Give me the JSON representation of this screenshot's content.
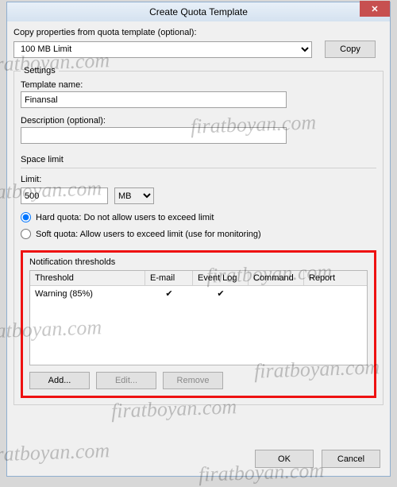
{
  "title": "Create Quota Template",
  "copy_label": "Copy properties from quota template (optional):",
  "template_select": "100 MB Limit",
  "copy_btn": "Copy",
  "settings_legend": "Settings",
  "tmpl_label": "Template name:",
  "tmpl_value": "Finansal",
  "desc_label": "Description (optional):",
  "desc_value": "",
  "space_label": "Space limit",
  "limit_label": "Limit:",
  "limit_value": "500",
  "unit": "MB",
  "hard_label": "Hard quota: Do not allow users to exceed limit",
  "soft_label": "Soft quota: Allow users to exceed limit (use for monitoring)",
  "notif_label": "Notification thresholds",
  "cols": {
    "threshold": "Threshold",
    "email": "E-mail",
    "eventlog": "Event Log",
    "command": "Command",
    "report": "Report"
  },
  "rows": [
    {
      "threshold": "Warning (85%)",
      "email": "✔",
      "eventlog": "✔",
      "command": "",
      "report": ""
    }
  ],
  "add_btn": "Add...",
  "edit_btn": "Edit...",
  "remove_btn": "Remove",
  "ok_btn": "OK",
  "cancel_btn": "Cancel",
  "watermark": "firatboyan.com"
}
